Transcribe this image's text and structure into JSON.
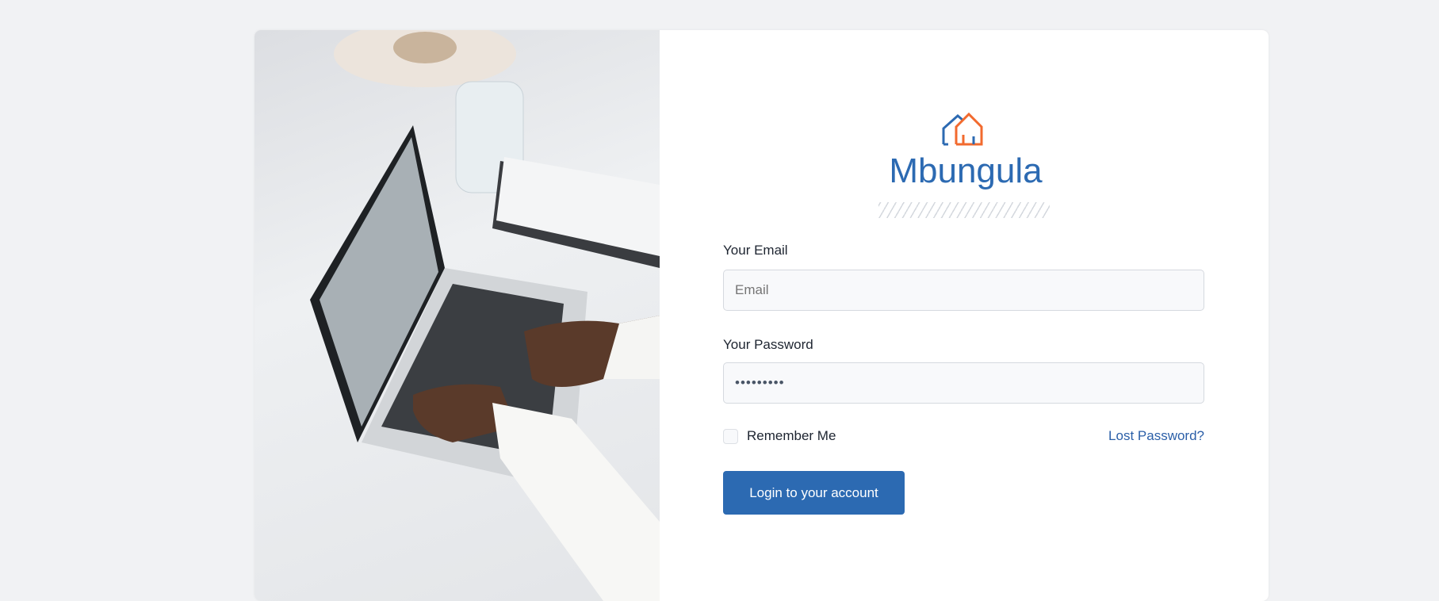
{
  "brand": {
    "name": "Mbungula",
    "primary_color": "#2c6ab2",
    "accent_color": "#f26a2e"
  },
  "form": {
    "email_label": "Your Email",
    "email_placeholder": "Email",
    "email_value": "",
    "password_label": "Your Password",
    "password_value": "•••••••••",
    "remember_label": "Remember Me",
    "lost_password": "Lost Password?",
    "submit": "Login to your account"
  }
}
